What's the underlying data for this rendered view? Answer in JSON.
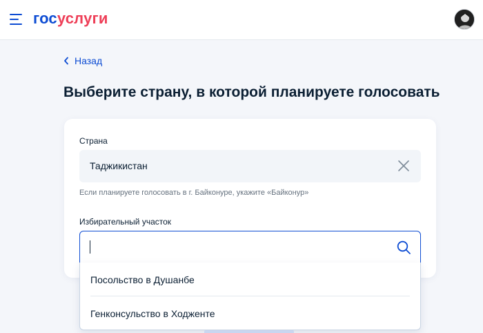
{
  "header": {
    "logo_part1": "гос",
    "logo_part2": "услуги",
    "logo_colors": {
      "blue": "#0d4cd3",
      "red": "#ee3f58"
    }
  },
  "nav": {
    "back_label": "Назад"
  },
  "page": {
    "title": "Выберите страну, в которой планируете голосовать"
  },
  "form": {
    "country": {
      "label": "Страна",
      "value": "Таджикистан",
      "hint": "Если планируете голосовать в г. Байконуре, укажите «Байконур»"
    },
    "district": {
      "label": "Избирательный участок",
      "value": "",
      "options": [
        "Посольство в Душанбе",
        "Генконсульство в Ходженте"
      ]
    }
  },
  "icons": {
    "menu": "menu-icon",
    "back": "chevron-left-icon",
    "clear": "close-icon",
    "search": "search-icon",
    "avatar": "avatar"
  },
  "colors": {
    "accent": "#0d4cd3",
    "text": "#0b1f33",
    "background": "#f4f6fa"
  }
}
